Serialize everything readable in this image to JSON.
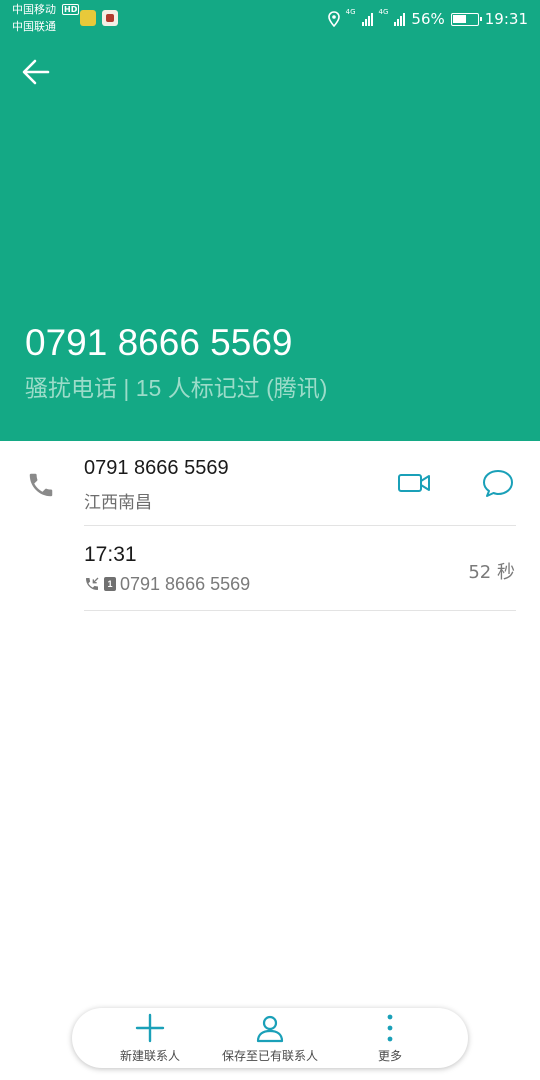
{
  "status_bar": {
    "carrier_1": "中国移动",
    "carrier_1_badge": "HD",
    "carrier_2": "中国联通",
    "network_1": "4G",
    "network_2": "4G",
    "battery_percent": "56%",
    "battery_level": 0.56,
    "time": "19:31"
  },
  "header": {
    "number": "0791 8666 5569",
    "tag": "骚扰电话 | 15 人标记过 (腾讯)",
    "background_color": "#14a985"
  },
  "contact": {
    "number": "0791 8666 5569",
    "location": "江西南昌"
  },
  "call_log": [
    {
      "time": "17:31",
      "sim": "1",
      "number": "0791 8666 5569",
      "duration": "52 秒"
    }
  ],
  "bottom_bar": {
    "new_contact": "新建联系人",
    "save_existing": "保存至已有联系人",
    "more": "更多"
  },
  "colors": {
    "accent": "#1aa0b8",
    "header": "#14a985"
  }
}
